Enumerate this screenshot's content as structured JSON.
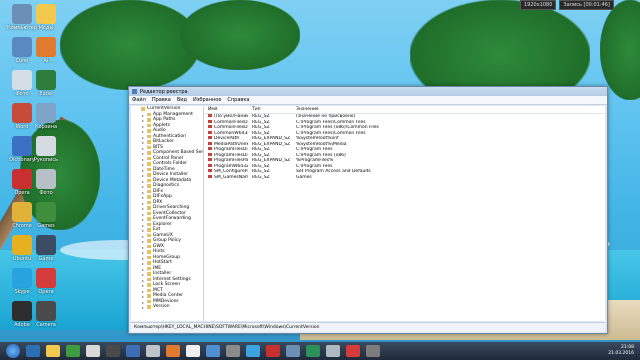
{
  "top_bar": {
    "resolution": "1920x1080",
    "recording": "Запись [00:01:46]"
  },
  "desktop_icons": [
    {
      "label": "Компьютер",
      "color": "#6e8fb5"
    },
    {
      "label": "Моды",
      "color": "#f2c94c"
    },
    {
      "label": "Corel",
      "color": "#5a89c2"
    },
    {
      "label": "AI",
      "color": "#e07a2f"
    },
    {
      "label": "Фото",
      "color": "#d5dde7"
    },
    {
      "label": "Excel",
      "color": "#2f7d3c"
    },
    {
      "label": "Word",
      "color": "#c84b3a"
    },
    {
      "label": "Корзина",
      "color": "#7da3c8"
    },
    {
      "label": "Dictionary",
      "color": "#3b6fc2"
    },
    {
      "label": "Рукопись",
      "color": "#d6dbe3"
    },
    {
      "label": "Opera",
      "color": "#c83030"
    },
    {
      "label": "Фото",
      "color": "#b7bfc7"
    },
    {
      "label": "Chrome",
      "color": "#e0b23a"
    },
    {
      "label": "Games",
      "color": "#3e8e3c"
    },
    {
      "label": "Ubuntu",
      "color": "#e7b021"
    },
    {
      "label": "Game",
      "color": "#3b4d63"
    },
    {
      "label": "Skype",
      "color": "#29a3e0"
    },
    {
      "label": "Opera",
      "color": "#d43b3b"
    },
    {
      "label": "Adobe",
      "color": "#2d2d2d"
    },
    {
      "label": "Camera",
      "color": "#4a4a4a"
    }
  ],
  "window": {
    "title": "Редактор реестра",
    "menu": [
      "Файл",
      "Правка",
      "Вид",
      "Избранное",
      "Справка"
    ],
    "tree": {
      "root": "CurrentVersion",
      "items": [
        "App Management",
        "App Paths",
        "Applets",
        "Audio",
        "Authentication",
        "BitLocker",
        "BITS",
        "Component Based Serv",
        "Control Panel",
        "Controls Folder",
        "DateTime",
        "Device Installer",
        "Device Metadata",
        "Diagnostics",
        "DIFx",
        "DIFxApp",
        "DPX",
        "DriverSearching",
        "EventCollector",
        "EventForwarding",
        "Explorer",
        "Ext",
        "GameUX",
        "Group Policy",
        "GWX",
        "Hints",
        "HomeGroup",
        "HotStart",
        "IME",
        "Installer",
        "Internet Settings",
        "Lock Screen",
        "MCT",
        "Media Center",
        "MMDevices",
        "Version"
      ]
    },
    "columns": [
      "Имя",
      "Тип",
      "Значение"
    ],
    "values": [
      {
        "name": "(По умолчанию)",
        "type": "REG_SZ",
        "data": "(значение не присвоено)"
      },
      {
        "name": "CommonFilesDir",
        "type": "REG_SZ",
        "data": "C:\\Program Files\\Common Files"
      },
      {
        "name": "CommonFilesDir...",
        "type": "REG_SZ",
        "data": "C:\\Program Files (x86)\\Common Files"
      },
      {
        "name": "CommonW6432Di...",
        "type": "REG_SZ",
        "data": "C:\\Program Files\\Common Files"
      },
      {
        "name": "DevicePath",
        "type": "REG_EXPAND_SZ",
        "data": "%SystemRoot%\\inf"
      },
      {
        "name": "MediaPathUnex...",
        "type": "REG_EXPAND_SZ",
        "data": "%SystemRoot%\\Media"
      },
      {
        "name": "ProgramFilesDir",
        "type": "REG_SZ",
        "data": "C:\\Program Files"
      },
      {
        "name": "ProgramFilesDir...",
        "type": "REG_SZ",
        "data": "C:\\Program Files (x86)"
      },
      {
        "name": "ProgramFilesPath",
        "type": "REG_EXPAND_SZ",
        "data": "%ProgramFiles%"
      },
      {
        "name": "ProgramW6432Dir",
        "type": "REG_SZ",
        "data": "C:\\Program Files"
      },
      {
        "name": "SM_ConfigureP...",
        "type": "REG_SZ",
        "data": "Set Program Access and Defaults"
      },
      {
        "name": "SM_GamesName",
        "type": "REG_SZ",
        "data": "Games"
      }
    ],
    "status": "Компьютер\\HKEY_LOCAL_MACHINE\\SOFTWARE\\Microsoft\\Windows\\CurrentVersion"
  },
  "taskbar": {
    "buttons": [
      "#2c6fb3",
      "#f2c94c",
      "#3f9b3f",
      "#d9d9d9",
      "#4a4a4a",
      "#3d6db5",
      "#bfc4c9",
      "#e07a2f",
      "#f0f0f0",
      "#4d8fd1",
      "#8c8c8c",
      "#3aa3e0",
      "#c83030",
      "#6e8fb5",
      "#2d8f59",
      "#b0b8c2",
      "#d43b3b",
      "#7d7d7d"
    ],
    "time": "21:08",
    "date": "21.03.2016"
  }
}
